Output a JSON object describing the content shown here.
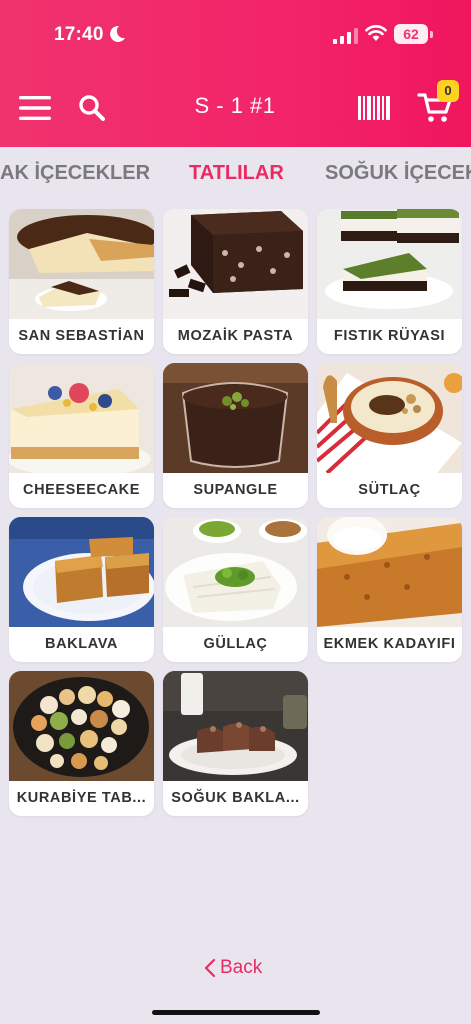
{
  "status": {
    "time": "17:40",
    "battery": "62"
  },
  "header": {
    "title": "S - 1 #1",
    "cart_count": "0"
  },
  "tabs": [
    {
      "label": "AK İÇECEKLER",
      "active": false
    },
    {
      "label": "TATLILAR",
      "active": true
    },
    {
      "label": "SOĞUK İÇECEKLER",
      "active": false
    }
  ],
  "products": [
    {
      "name": "SAN SEBASTİAN"
    },
    {
      "name": "MOZAİK PASTA"
    },
    {
      "name": "FISTIK RÜYASI"
    },
    {
      "name": "CHEESEECAKE"
    },
    {
      "name": "SUPANGLE"
    },
    {
      "name": "SÜTLAÇ"
    },
    {
      "name": "BAKLAVA"
    },
    {
      "name": "GÜLLAÇ"
    },
    {
      "name": "EKMEK KADAYIFI"
    },
    {
      "name": "KURABİYE TAB..."
    },
    {
      "name": "SOĞUK BAKLA..."
    }
  ],
  "footer": {
    "back_label": "Back"
  },
  "colors": {
    "accent": "#ea2a63",
    "header": "#f0336d",
    "background": "#e9e5ee",
    "badge": "#ffd21f"
  },
  "icons": [
    "moon-icon",
    "signal-icon",
    "wifi-icon",
    "menu-icon",
    "search-icon",
    "barcode-icon",
    "cart-icon",
    "chevron-left-icon"
  ]
}
